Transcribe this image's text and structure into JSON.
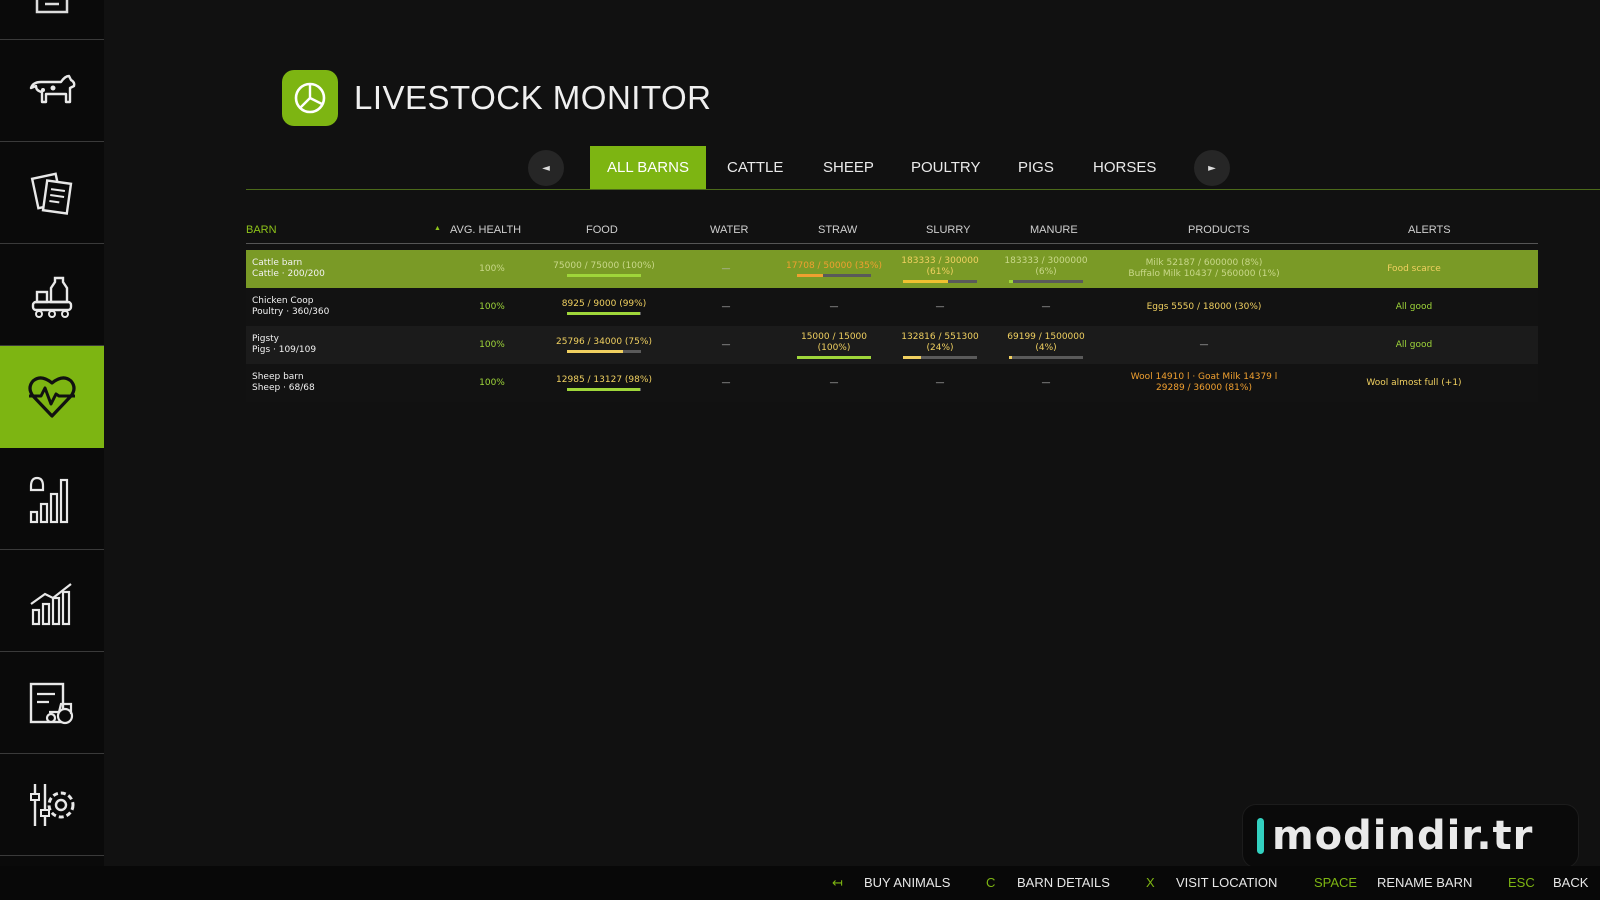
{
  "app": {
    "title": "LIVESTOCK MONITOR"
  },
  "sidebar": {
    "items": [
      {
        "icon": "menu-icon"
      },
      {
        "icon": "cow-icon"
      },
      {
        "icon": "contracts-icon"
      },
      {
        "icon": "production-icon"
      },
      {
        "icon": "heartbeat-icon",
        "active": true
      },
      {
        "icon": "price-alert-icon"
      },
      {
        "icon": "statistics-icon"
      },
      {
        "icon": "vehicle-list-icon"
      },
      {
        "icon": "settings-icon"
      }
    ]
  },
  "tabs": {
    "prev": "◄",
    "next": "►",
    "items": [
      "ALL BARNS",
      "CATTLE",
      "SHEEP",
      "POULTRY",
      "PIGS",
      "HORSES"
    ],
    "active_index": 0
  },
  "table": {
    "headers": {
      "barn": "BARN",
      "sort": "▲",
      "health": "AVG. HEALTH",
      "food": "FOOD",
      "water": "WATER",
      "straw": "STRAW",
      "slurry": "SLURRY",
      "manure": "MANURE",
      "products": "PRODUCTS",
      "alerts": "ALERTS"
    },
    "rows": [
      {
        "name": "Cattle barn",
        "sub": "Cattle · 200/200",
        "health": "100%",
        "food": "75000 / 75000  (100%)",
        "food_pct": 1.0,
        "water": "—",
        "straw": "17708 / 50000  (35%)",
        "straw_pct": 0.35,
        "slurry": "183333 / 300000",
        "slurry2": "(61%)",
        "slurry_pct": 0.61,
        "manure": "183333 / 3000000",
        "manure2": "(6%)",
        "manure_pct": 0.06,
        "products": "Milk 52187 / 600000  (8%)",
        "products2": "Buffalo Milk 10437 / 560000  (1%)",
        "alert": "Food scarce"
      },
      {
        "name": "Chicken Coop",
        "sub": "Poultry · 360/360",
        "health": "100%",
        "food": "8925 / 9000  (99%)",
        "food_pct": 0.99,
        "water": "—",
        "straw": "—",
        "slurry": "—",
        "manure": "—",
        "products": "Eggs 5550 / 18000  (30%)",
        "alert": "All good"
      },
      {
        "name": "Pigsty",
        "sub": "Pigs · 109/109",
        "health": "100%",
        "food": "25796 / 34000  (75%)",
        "food_pct": 0.75,
        "water": "—",
        "straw": "15000 / 15000",
        "straw2": "(100%)",
        "straw_pct": 1.0,
        "slurry": "132816 / 551300",
        "slurry2": "(24%)",
        "slurry_pct": 0.24,
        "manure": "69199 / 1500000",
        "manure2": "(4%)",
        "manure_pct": 0.04,
        "products": "—",
        "alert": "All good"
      },
      {
        "name": "Sheep barn",
        "sub": "Sheep · 68/68",
        "health": "100%",
        "food": "12985 / 13127  (98%)",
        "food_pct": 0.98,
        "water": "—",
        "straw": "—",
        "slurry": "—",
        "manure": "—",
        "products": "Wool 14910 l · Goat Milk 14379 l",
        "products2": "29289 / 36000  (81%)",
        "alert": "Wool almost full (+1)"
      }
    ]
  },
  "footer": {
    "actions": [
      {
        "key": "↤",
        "label": "BUY ANIMALS"
      },
      {
        "key": "C",
        "label": "BARN DETAILS"
      },
      {
        "key": "X",
        "label": "VISIT LOCATION"
      },
      {
        "key": "SPACE",
        "label": "RENAME BARN"
      },
      {
        "key": "ESC",
        "label": "BACK"
      }
    ]
  },
  "watermark": {
    "text": "modindir.tr"
  },
  "colors": {
    "accent": "#7db512",
    "warning": "#f0a030",
    "ok": "#9fd63a"
  }
}
